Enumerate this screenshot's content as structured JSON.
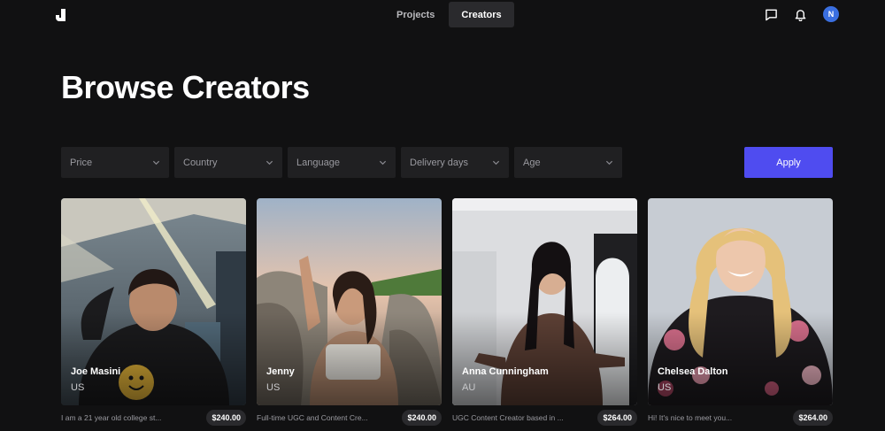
{
  "nav": {
    "tabs": [
      {
        "label": "Projects",
        "active": false
      },
      {
        "label": "Creators",
        "active": true
      }
    ]
  },
  "user": {
    "avatar_initial": "N",
    "avatar_color": "#3a6fe0"
  },
  "page": {
    "title": "Browse Creators"
  },
  "filters": {
    "items": [
      "Price",
      "Country",
      "Language",
      "Delivery days",
      "Age"
    ],
    "apply_label": "Apply",
    "accent": "#4f4cf0"
  },
  "creators": [
    {
      "name": "Joe Masini",
      "country": "US",
      "bio": "I am a 21 year old college st...",
      "price": "$240.00"
    },
    {
      "name": "Jenny",
      "country": "US",
      "bio": "Full-time UGC and Content Cre...",
      "price": "$240.00"
    },
    {
      "name": "Anna Cunningham",
      "country": "AU",
      "bio": "UGC Content Creator based in ...",
      "price": "$264.00"
    },
    {
      "name": "Chelsea Dalton",
      "country": "US",
      "bio": "Hi! It's nice to meet you...",
      "price": "$264.00"
    }
  ]
}
